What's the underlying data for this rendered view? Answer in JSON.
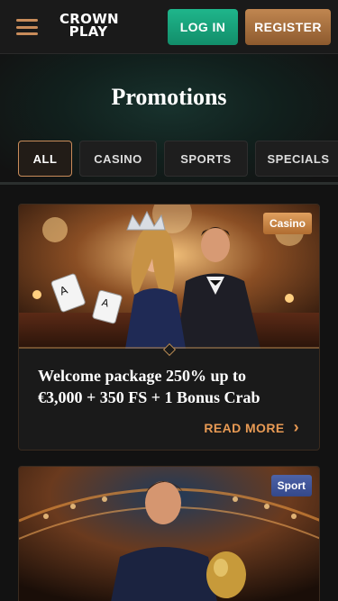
{
  "header": {
    "logo_line1": "CROWN",
    "logo_line2": "PLAY",
    "login_label": "LOG IN",
    "register_label": "REGISTER"
  },
  "page_title": "Promotions",
  "tabs": [
    {
      "label": "ALL",
      "active": true
    },
    {
      "label": "CASINO",
      "active": false
    },
    {
      "label": "SPORTS",
      "active": false
    },
    {
      "label": "SPECIALS",
      "active": false
    }
  ],
  "promos": [
    {
      "badge": "Casino",
      "title_line1": "Welcome package 250% up to",
      "title_line2": "€3,000 + 350 FS + 1 Bonus Crab",
      "cta": "READ MORE"
    },
    {
      "badge": "Sport"
    }
  ],
  "colors": {
    "accent": "#c98c5a",
    "login": "#1fb68b",
    "register": "#c08650",
    "background": "#121212"
  }
}
